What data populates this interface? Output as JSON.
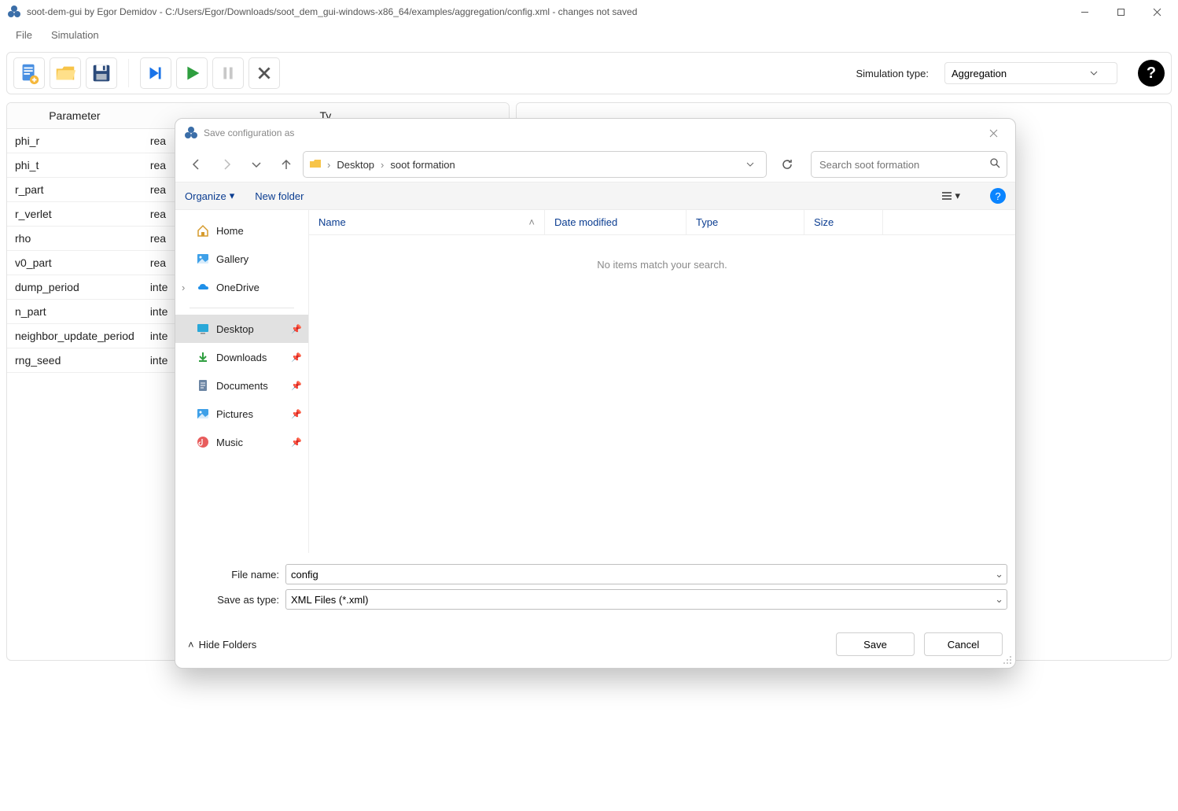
{
  "window": {
    "title": "soot-dem-gui by Egor Demidov - C:/Users/Egor/Downloads/soot_dem_gui-windows-x86_64/examples/aggregation/config.xml - changes not saved"
  },
  "menu": {
    "file": "File",
    "simulation": "Simulation"
  },
  "toolbar": {
    "simtype_label": "Simulation type:",
    "simtype_value": "Aggregation",
    "help": "?"
  },
  "paramTable": {
    "headers": {
      "param": "Parameter",
      "type": "Ty"
    },
    "rows": [
      {
        "name": "phi_r",
        "type": "rea"
      },
      {
        "name": "phi_t",
        "type": "rea"
      },
      {
        "name": "r_part",
        "type": "rea"
      },
      {
        "name": "r_verlet",
        "type": "rea"
      },
      {
        "name": "rho",
        "type": "rea"
      },
      {
        "name": "v0_part",
        "type": "rea"
      },
      {
        "name": "dump_period",
        "type": "inte"
      },
      {
        "name": "n_part",
        "type": "inte"
      },
      {
        "name": "neighbor_update_period",
        "type": "inte"
      },
      {
        "name": "rng_seed",
        "type": "inte"
      }
    ]
  },
  "dialog": {
    "title": "Save configuration as",
    "breadcrumbs": [
      "Desktop",
      "soot formation"
    ],
    "search_placeholder": "Search soot formation",
    "organize": "Organize",
    "newfolder": "New folder",
    "nav": {
      "home": "Home",
      "gallery": "Gallery",
      "onedrive": "OneDrive",
      "desktop": "Desktop",
      "downloads": "Downloads",
      "documents": "Documents",
      "pictures": "Pictures",
      "music": "Music"
    },
    "columns": {
      "name": "Name",
      "date": "Date modified",
      "type": "Type",
      "size": "Size"
    },
    "empty_msg": "No items match your search.",
    "filename_label": "File name:",
    "filename_value": "config",
    "saveas_label": "Save as type:",
    "saveas_value": "XML Files (*.xml)",
    "hide_folders": "Hide Folders",
    "save": "Save",
    "cancel": "Cancel"
  }
}
